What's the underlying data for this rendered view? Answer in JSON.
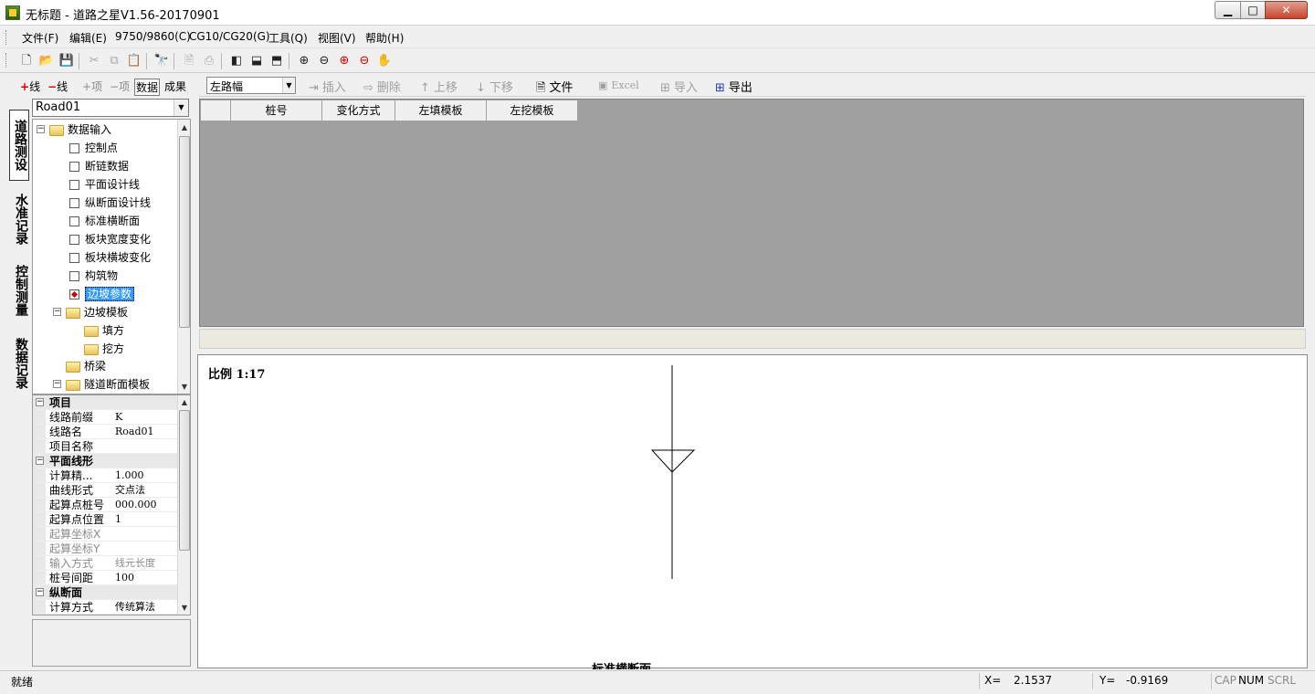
{
  "window": {
    "title": "无标题 - 道路之星V1.56-20170901",
    "min_glyph": "▁",
    "max_glyph": "□",
    "close_glyph": "✕"
  },
  "menu": [
    "文件(F)",
    "编辑(E)",
    "9750/9860(C)",
    "CG10/CG20(G)",
    "工具(Q)",
    "视图(V)",
    "帮助(H)"
  ],
  "toolbar": [
    {
      "icon": "new-file-icon",
      "glyph": "🗋",
      "enabled": true
    },
    {
      "icon": "open-folder-icon",
      "glyph": "📂",
      "enabled": true
    },
    {
      "icon": "save-icon",
      "glyph": "💾",
      "enabled": false
    },
    {
      "icon": "cut-icon",
      "glyph": "✂",
      "enabled": false
    },
    {
      "icon": "copy-icon",
      "glyph": "⧉",
      "enabled": false
    },
    {
      "icon": "paste-icon",
      "glyph": "📋",
      "enabled": false
    },
    {
      "icon": "find-icon",
      "glyph": "🔭",
      "enabled": true
    },
    {
      "icon": "print-preview-icon",
      "glyph": "🗎",
      "enabled": false
    },
    {
      "icon": "print-icon",
      "glyph": "⎙",
      "enabled": false
    },
    {
      "icon": "layout-left-icon",
      "glyph": "◧",
      "enabled": true
    },
    {
      "icon": "layout-bottom-icon",
      "glyph": "⬓",
      "enabled": true
    },
    {
      "icon": "layout-top-icon",
      "glyph": "⬒",
      "enabled": true
    },
    {
      "icon": "zoom-fit-icon",
      "glyph": "⊕",
      "enabled": true
    },
    {
      "icon": "zoom-out-icon",
      "glyph": "⊖",
      "enabled": true
    },
    {
      "icon": "zoom-in-icon",
      "glyph": "⊕",
      "enabled": true
    },
    {
      "icon": "zoom-minus-icon",
      "glyph": "⊖",
      "enabled": true
    },
    {
      "icon": "pan-hand-icon",
      "glyph": "✋",
      "enabled": true
    }
  ],
  "left_tabs": {
    "add_line": "线",
    "remove_line": "线",
    "add_item": "项",
    "remove_item": "项",
    "data": "数据",
    "results": "成果"
  },
  "vertical_tabs": [
    "道路测设",
    "水准记录",
    "控制测量",
    "数据记录"
  ],
  "road_select": "Road01",
  "tree": [
    {
      "label": "数据输入",
      "kind": "folder",
      "level": 0,
      "expander": "−"
    },
    {
      "label": "控制点",
      "kind": "check",
      "level": 1
    },
    {
      "label": "断链数据",
      "kind": "check",
      "level": 1
    },
    {
      "label": "平面设计线",
      "kind": "check",
      "level": 1
    },
    {
      "label": "纵断面设计线",
      "kind": "check",
      "level": 1
    },
    {
      "label": "标准横断面",
      "kind": "check",
      "level": 1
    },
    {
      "label": "板块宽度变化",
      "kind": "check",
      "level": 1
    },
    {
      "label": "板块横坡变化",
      "kind": "check",
      "level": 1
    },
    {
      "label": "构筑物",
      "kind": "check",
      "level": 1
    },
    {
      "label": "边坡参数",
      "kind": "check-red",
      "level": 1,
      "selected": true
    },
    {
      "label": "边坡模板",
      "kind": "folder",
      "level": 1,
      "expander": "−"
    },
    {
      "label": "填方",
      "kind": "folder",
      "level": 2
    },
    {
      "label": "挖方",
      "kind": "folder",
      "level": 2
    },
    {
      "label": "桥梁",
      "kind": "folder",
      "level": 1
    },
    {
      "label": "隧道断面模板",
      "kind": "folder",
      "level": 1,
      "expander": "−"
    }
  ],
  "properties": [
    {
      "cat": "项目"
    },
    {
      "k": "线路前缀",
      "v": "K"
    },
    {
      "k": "线路名",
      "v": "Road01"
    },
    {
      "k": "项目名称",
      "v": ""
    },
    {
      "cat": "平面线形"
    },
    {
      "k": "计算精...",
      "v": "  1.000"
    },
    {
      "k": "曲线形式",
      "v": "交点法"
    },
    {
      "k": "起算点桩号",
      "v": "  000.000"
    },
    {
      "k": "起算点位置",
      "v": "1"
    },
    {
      "k": "起算坐标X",
      "v": "",
      "gray": true
    },
    {
      "k": "起算坐标Y",
      "v": "",
      "gray": true
    },
    {
      "k": "输入方式",
      "v": "线元长度",
      "gray": true
    },
    {
      "k": "桩号间距",
      "v": "100"
    },
    {
      "cat": "纵断面"
    },
    {
      "k": "计算方式",
      "v": "传统算法"
    }
  ],
  "right_toolbar": {
    "side_select": "左路幅",
    "insert": "插入",
    "delete": "删除",
    "move_up": "上移",
    "move_down": "下移",
    "file": "文件",
    "excel": "Excel",
    "import": "导入",
    "export": "导出"
  },
  "grid_headers": [
    "",
    "桩号",
    "变化方式",
    "左填模板",
    "左挖模板"
  ],
  "drawing": {
    "scale": "比例 1:17",
    "caption": "标准横断面"
  },
  "status": {
    "ready": "就绪",
    "x_label": "X=",
    "x_value": "2.1537",
    "y_label": "Y=",
    "y_value": "-0.9169",
    "cap": "CAP",
    "num": "NUM",
    "scrl": "SCRL"
  }
}
